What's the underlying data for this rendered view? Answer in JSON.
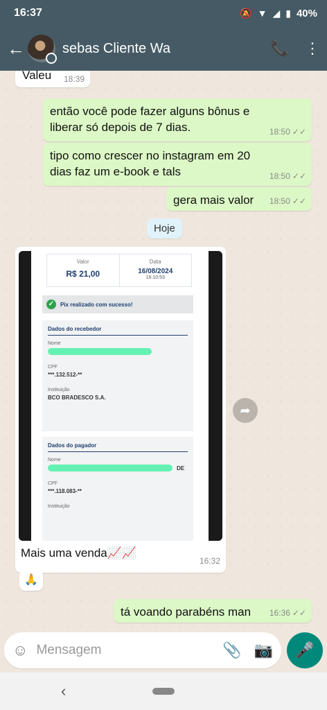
{
  "status": {
    "time": "16:37",
    "battery": "40%"
  },
  "header": {
    "contact_name": "sebas Cliente Wa"
  },
  "messages": [
    {
      "text": "Valeu",
      "time": "18:39"
    },
    {
      "text": "então você pode fazer alguns bônus e liberar só depois de 7 dias.",
      "time": "18:50"
    },
    {
      "text": "tipo como crescer no instagram em 20 dias faz um e-book e tals",
      "time": "18:50"
    },
    {
      "text": "gera mais valor",
      "time": "18:50"
    },
    {
      "text": "tá voando parabéns man",
      "time": "16:36"
    }
  ],
  "day_label": "Hoje",
  "image_message": {
    "caption": "Mais uma venda📈📈",
    "time": "16:32",
    "receipt": {
      "valor_label": "Valor",
      "valor": "R$ 21,00",
      "data_label": "Data",
      "data": "16/08/2024",
      "hora": "16:10:53",
      "success": "Pix realizado com sucesso!",
      "recebedor_title": "Dados do recebedor",
      "nome_label": "Nome",
      "cpf_label": "CPF",
      "recebedor_cpf": "***.132.512-**",
      "instituicao_label": "Instituição",
      "recebedor_inst": "BCO BRADESCO S.A.",
      "pagador_title": "Dados do pagador",
      "pagador_nome_suffix": "DE",
      "pagador_cpf": "***.118.083-**"
    }
  },
  "reaction": "🙏",
  "input": {
    "placeholder": "Mensagem"
  }
}
